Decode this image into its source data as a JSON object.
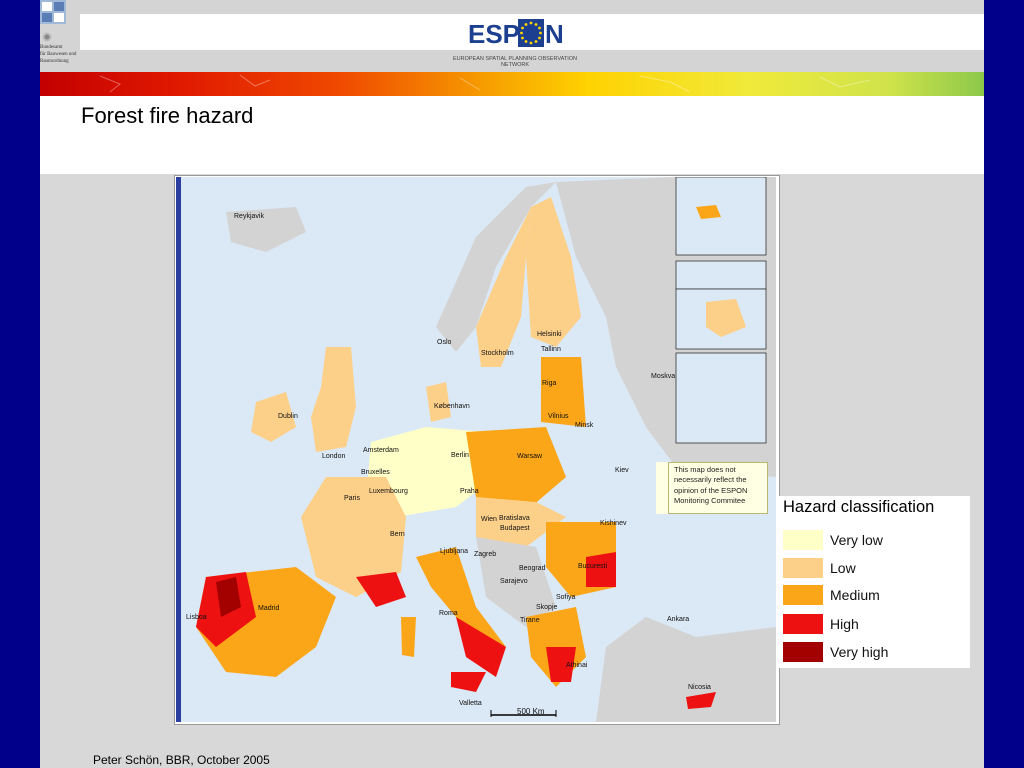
{
  "header": {
    "bbr_lines": [
      "Bundesamt",
      "für Bauwesen und",
      "Raumordnung"
    ],
    "espon_logo_text": "ESPON",
    "espon_subtitle": "EUROPEAN SPATIAL PLANNING OBSERVATION NETWORK"
  },
  "title": "Forest fire hazard",
  "disclaimer": "This map does not necessarily reflect the opinion of the ESPON Monitoring Commitee",
  "legend": {
    "title": "Hazard classification",
    "items": [
      {
        "label": "Very low",
        "color": "#ffffc8"
      },
      {
        "label": "Low",
        "color": "#fdd08a"
      },
      {
        "label": "Medium",
        "color": "#fba618"
      },
      {
        "label": "High",
        "color": "#ee1111"
      },
      {
        "label": "Very high",
        "color": "#a30000"
      }
    ]
  },
  "map": {
    "cities": [
      "Reykjavik",
      "Oslo",
      "Helsinki",
      "Tallinn",
      "Stockholm",
      "Moskva",
      "Riga",
      "Dublin",
      "København",
      "Vilnius",
      "Minsk",
      "London",
      "Amsterdam",
      "Berlin",
      "Warsaw",
      "Bruxelles",
      "Kiev",
      "Luxembourg",
      "Praha",
      "Paris",
      "Wien",
      "Bratislava",
      "Budapest",
      "Kishinev",
      "Bern",
      "Ljubljana",
      "Zagreb",
      "Beograd",
      "Bucuresti",
      "Sarajevo",
      "Sofiya",
      "Skopje",
      "Madrid",
      "Lisboa",
      "Roma",
      "Tirane",
      "Ankara",
      "Athinai",
      "Valletta",
      "Nicosia"
    ],
    "scale_label": "500 Km"
  },
  "footer": "Peter Schön, BBR, October 2005"
}
